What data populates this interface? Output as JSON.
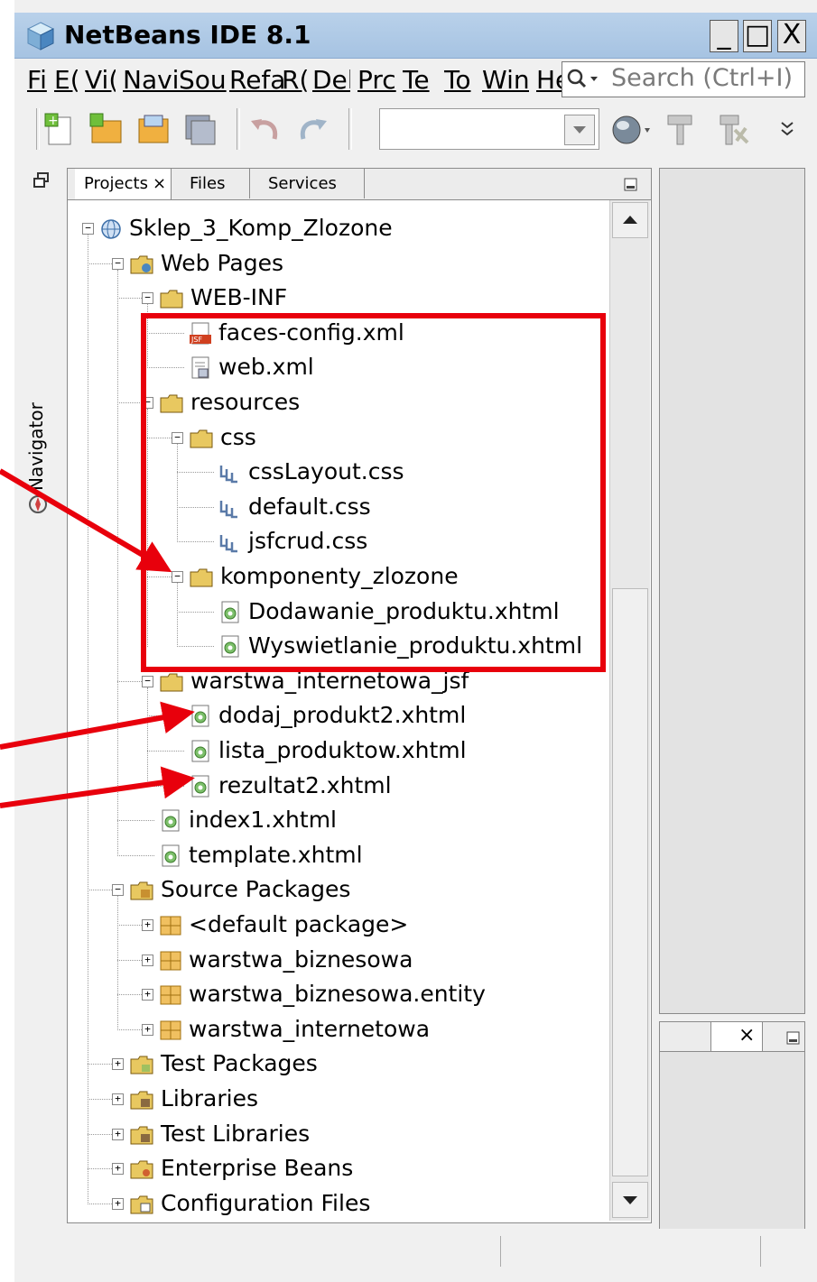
{
  "window": {
    "title": "NetBeans IDE 8.1",
    "minimize": "_",
    "maximize": "□",
    "close": "X"
  },
  "menu": [
    {
      "label": "File",
      "visible": "Fi"
    },
    {
      "label": "Edit",
      "visible": "E("
    },
    {
      "label": "View",
      "visible": "Vi("
    },
    {
      "label": "Navigate",
      "visible": "Navi"
    },
    {
      "label": "Source",
      "visible": "Sou"
    },
    {
      "label": "Refactor",
      "visible": "Refa"
    },
    {
      "label": "Run",
      "visible": "R("
    },
    {
      "label": "Debug",
      "visible": "Del"
    },
    {
      "label": "Profile",
      "visible": "Prc"
    },
    {
      "label": "Team",
      "visible": "Te"
    },
    {
      "label": "Tools",
      "visible": "To"
    },
    {
      "label": "Window",
      "visible": "Win"
    },
    {
      "label": "Help",
      "visible": "He"
    }
  ],
  "search": {
    "placeholder": "Search (Ctrl+I)"
  },
  "side": {
    "navigator": "Navigator"
  },
  "tabs": {
    "projects": "Projects",
    "close": "×",
    "files": "Files",
    "services": "Services"
  },
  "tree": [
    {
      "label": "Sklep_3_Komp_Zlozone",
      "icon": "globe-icon",
      "toggle": "−"
    },
    {
      "label": "Web Pages",
      "icon": "web-folder-icon",
      "toggle": "−"
    },
    {
      "label": "WEB-INF",
      "icon": "folder-icon",
      "toggle": "−"
    },
    {
      "label": "faces-config.xml",
      "icon": "jsf-file-icon",
      "toggle": ""
    },
    {
      "label": "web.xml",
      "icon": "xml-file-icon",
      "toggle": ""
    },
    {
      "label": "resources",
      "icon": "folder-icon",
      "toggle": "−"
    },
    {
      "label": "css",
      "icon": "folder-icon",
      "toggle": "−"
    },
    {
      "label": "cssLayout.css",
      "icon": "css-file-icon",
      "toggle": ""
    },
    {
      "label": "default.css",
      "icon": "css-file-icon",
      "toggle": ""
    },
    {
      "label": "jsfcrud.css",
      "icon": "css-file-icon",
      "toggle": ""
    },
    {
      "label": "komponenty_zlozone",
      "icon": "folder-icon",
      "toggle": "−"
    },
    {
      "label": "Dodawanie_produktu.xhtml",
      "icon": "xhtml-file-icon",
      "toggle": ""
    },
    {
      "label": "Wyswietlanie_produktu.xhtml",
      "icon": "xhtml-file-icon",
      "toggle": ""
    },
    {
      "label": "warstwa_internetowa_jsf",
      "icon": "folder-icon",
      "toggle": "−"
    },
    {
      "label": "dodaj_produkt2.xhtml",
      "icon": "xhtml-file-icon",
      "toggle": ""
    },
    {
      "label": "lista_produktow.xhtml",
      "icon": "xhtml-file-icon",
      "toggle": ""
    },
    {
      "label": "rezultat2.xhtml",
      "icon": "xhtml-file-icon",
      "toggle": ""
    },
    {
      "label": "index1.xhtml",
      "icon": "xhtml-file-icon",
      "toggle": ""
    },
    {
      "label": "template.xhtml",
      "icon": "xhtml-file-icon",
      "toggle": ""
    },
    {
      "label": "Source Packages",
      "icon": "source-folder-icon",
      "toggle": "−"
    },
    {
      "label": "<default package>",
      "icon": "package-icon",
      "toggle": "+"
    },
    {
      "label": "warstwa_biznesowa",
      "icon": "package-icon",
      "toggle": "+"
    },
    {
      "label": "warstwa_biznesowa.entity",
      "icon": "package-icon",
      "toggle": "+"
    },
    {
      "label": "warstwa_internetowa",
      "icon": "package-icon",
      "toggle": "+"
    },
    {
      "label": "Test Packages",
      "icon": "test-folder-icon",
      "toggle": "+"
    },
    {
      "label": "Libraries",
      "icon": "library-folder-icon",
      "toggle": "+"
    },
    {
      "label": "Test Libraries",
      "icon": "library-folder-icon",
      "toggle": "+"
    },
    {
      "label": "Enterprise Beans",
      "icon": "beans-folder-icon",
      "toggle": "+"
    },
    {
      "label": "Configuration Files",
      "icon": "config-folder-icon",
      "toggle": "+"
    }
  ],
  "right_panel": {
    "close": "×",
    "minimize": "▭"
  },
  "colors": {
    "highlight": "#e8000c",
    "titlebar": "#b9d1ea",
    "folder": "#e8c860"
  }
}
